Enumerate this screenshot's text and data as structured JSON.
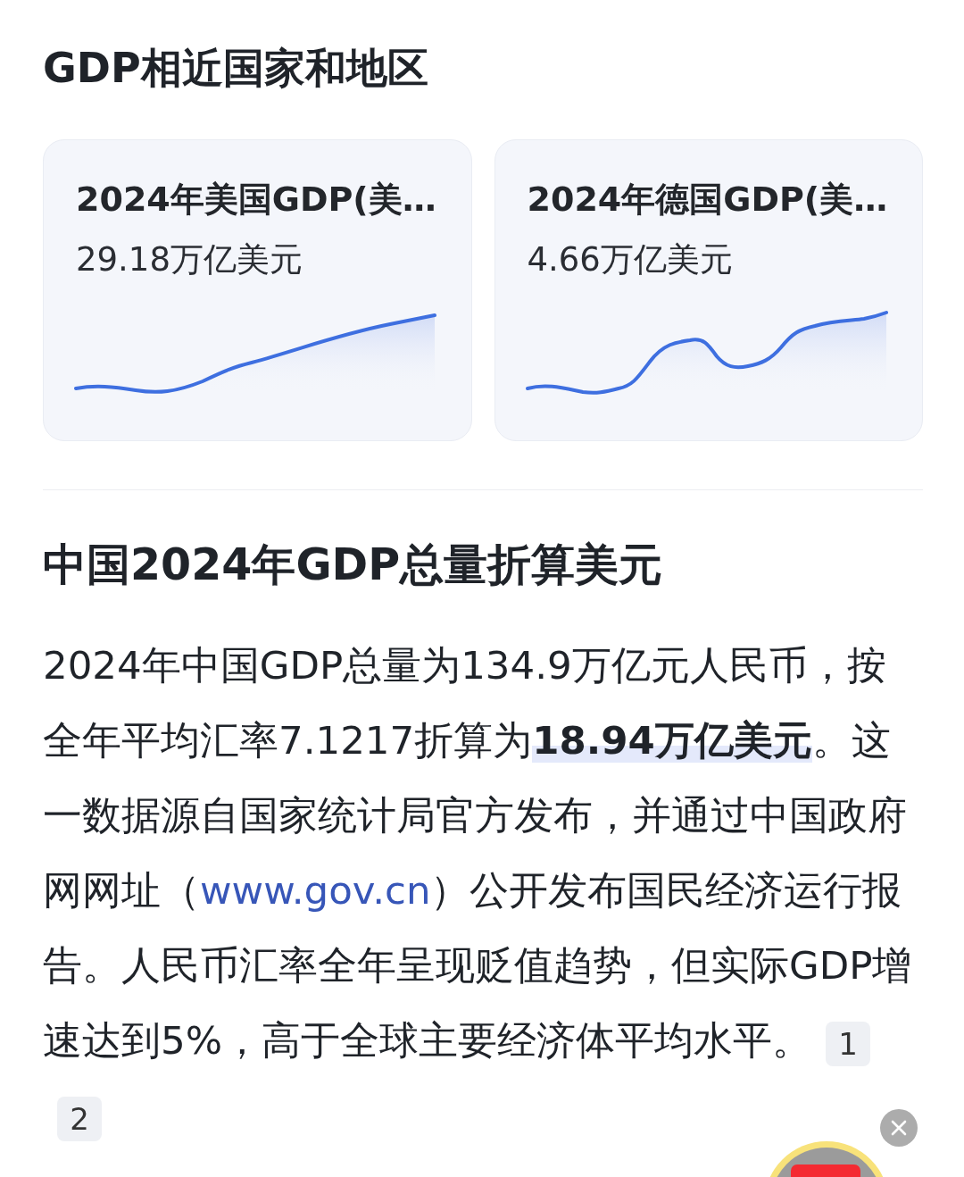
{
  "section_title": "GDP相近国家和地区",
  "cards": [
    {
      "title": "2024年美国GDP(美…",
      "value": "29.18万亿美元"
    },
    {
      "title": "2024年德国GDP(美…",
      "value": "4.66万亿美元"
    }
  ],
  "article": {
    "title": "中国2024年GDP总量折算美元",
    "paragraph_before": "2024年中国GDP总量为134.9万亿元人民币，按全年平均汇率7.1217折算为**18.94万亿美元**。这一数据源自国家统计局官方发布，并通过中国政府网网址（",
    "link": "www.gov.cn",
    "paragraph_after": "）公开发布国民经济运行报告。人民币汇率全年呈现贬值趋势，但实际GDP增速达到5%，高于全球主要经济体平均水平。",
    "citations": [
      "1",
      "2"
    ]
  }
}
